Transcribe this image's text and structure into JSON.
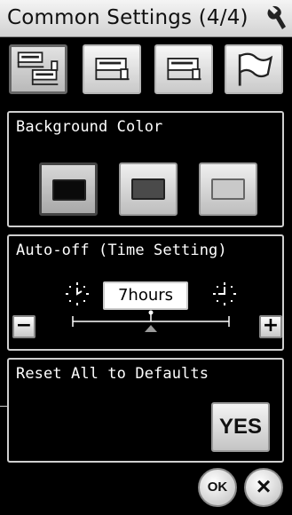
{
  "header": {
    "title": "Common Settings (4/4)",
    "wrench_icon": "wrench-icon"
  },
  "tabs": [
    {
      "icon": "machine-multi-icon",
      "active": true
    },
    {
      "icon": "machine-icon",
      "active": false
    },
    {
      "icon": "machine-icon",
      "active": false
    },
    {
      "icon": "flag-icon",
      "active": false
    }
  ],
  "background_color": {
    "label": "Background Color",
    "options": [
      {
        "name": "black",
        "swatch": "#0a0a0a"
      },
      {
        "name": "dark-gray",
        "swatch": "#4a4a4a"
      },
      {
        "name": "light-gray",
        "swatch": "#c9c9c9"
      }
    ],
    "selected": "black"
  },
  "auto_off": {
    "label": "Auto-off (Time Setting)",
    "value": "7hours",
    "minus_label": "−",
    "plus_label": "+"
  },
  "reset": {
    "label": "Reset All to Defaults",
    "yes_label": "YES"
  },
  "footer": {
    "ok_label": "OK",
    "close_label": "×"
  }
}
